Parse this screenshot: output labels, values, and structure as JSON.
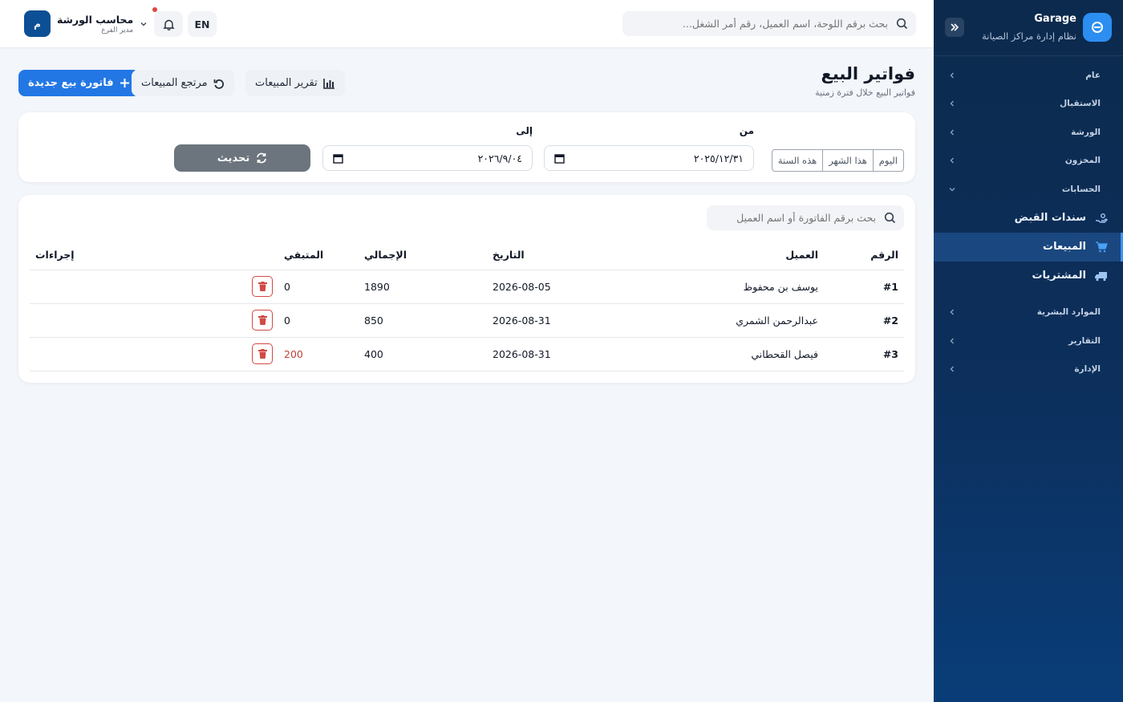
{
  "sidebar": {
    "brand": "Garage",
    "subtitle": "نظام إدارة مراكز الصيانة",
    "sections": [
      {
        "label": "عام"
      },
      {
        "label": "الاستقبال"
      },
      {
        "label": "الورشة"
      },
      {
        "label": "المخزون"
      },
      {
        "label": "الحسابات"
      }
    ],
    "accounts_items": [
      {
        "label": "سندات القبض",
        "icon": "hand-money-icon"
      },
      {
        "label": "المبيعات",
        "icon": "cart-icon"
      },
      {
        "label": "المشتريات",
        "icon": "truck-icon"
      }
    ],
    "sections_after": [
      {
        "label": "الموارد البشرية"
      },
      {
        "label": "التقارير"
      },
      {
        "label": "الإدارة"
      }
    ]
  },
  "topbar": {
    "search_placeholder": "بحث برقم اللوحة، اسم العميل، رقم أمر الشغل...",
    "lang": "EN",
    "user_initial": "م",
    "user_name": "محاسب الورشة",
    "user_role": "مدير الفرع"
  },
  "page": {
    "title": "فواتير البيع",
    "subtitle": "فواتير البيع خلال فترة زمنية",
    "btn_new": "فاتورة بيع جديدة",
    "btn_returns": "مرتجع المبيعات",
    "btn_report": "تقرير المبيعات"
  },
  "filter": {
    "range_buttons": [
      "اليوم",
      "هذا الشهر",
      "هذه السنة"
    ],
    "from_label": "من",
    "to_label": "إلى",
    "from_value": "٢٠٢٥/١٢/٣١",
    "to_value": "٢٠٢٦/٩/٠٤",
    "refresh_label": "تحديث"
  },
  "table": {
    "search_placeholder": "بحث برقم الفاتورة أو اسم العميل",
    "headers": {
      "number": "الرقم",
      "customer": "العميل",
      "date": "التاريخ",
      "total": "الإجمالي",
      "remaining": "المتبقي",
      "actions": "إجراءات"
    },
    "rows": [
      {
        "number": "#1",
        "customer": "يوسف بن محفوظ",
        "date": "2026-08-05",
        "total": "1890",
        "remaining": "0"
      },
      {
        "number": "#2",
        "customer": "عبدالرحمن الشمري",
        "date": "2026-08-31",
        "total": "850",
        "remaining": "0"
      },
      {
        "number": "#3",
        "customer": "فيصل القحطاني",
        "date": "2026-08-31",
        "total": "400",
        "remaining": "200"
      }
    ]
  },
  "colors": {
    "primary": "#2277e4",
    "sidebar": "#0c2a4d",
    "danger": "#d04a43",
    "remaining_due": "#c2423a"
  }
}
